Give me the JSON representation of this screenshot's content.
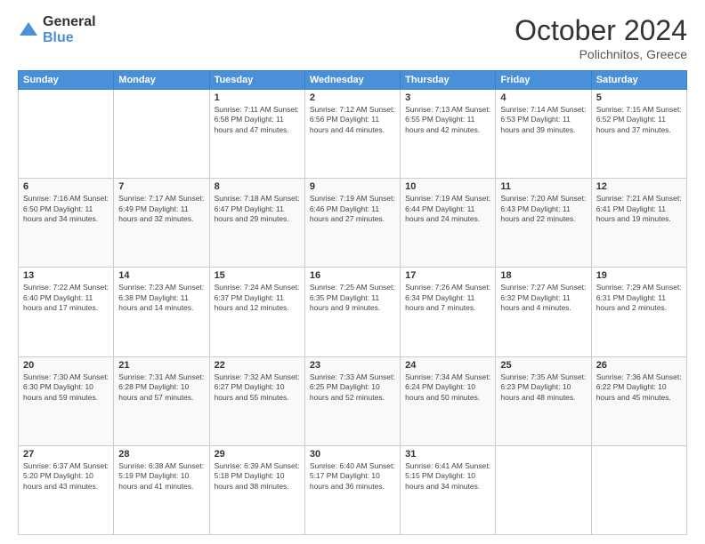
{
  "logo": {
    "general": "General",
    "blue": "Blue"
  },
  "header": {
    "month": "October 2024",
    "location": "Polichnitos, Greece"
  },
  "weekdays": [
    "Sunday",
    "Monday",
    "Tuesday",
    "Wednesday",
    "Thursday",
    "Friday",
    "Saturday"
  ],
  "weeks": [
    [
      {
        "day": "",
        "info": ""
      },
      {
        "day": "",
        "info": ""
      },
      {
        "day": "1",
        "info": "Sunrise: 7:11 AM\nSunset: 6:58 PM\nDaylight: 11 hours and 47 minutes."
      },
      {
        "day": "2",
        "info": "Sunrise: 7:12 AM\nSunset: 6:56 PM\nDaylight: 11 hours and 44 minutes."
      },
      {
        "day": "3",
        "info": "Sunrise: 7:13 AM\nSunset: 6:55 PM\nDaylight: 11 hours and 42 minutes."
      },
      {
        "day": "4",
        "info": "Sunrise: 7:14 AM\nSunset: 6:53 PM\nDaylight: 11 hours and 39 minutes."
      },
      {
        "day": "5",
        "info": "Sunrise: 7:15 AM\nSunset: 6:52 PM\nDaylight: 11 hours and 37 minutes."
      }
    ],
    [
      {
        "day": "6",
        "info": "Sunrise: 7:16 AM\nSunset: 6:50 PM\nDaylight: 11 hours and 34 minutes."
      },
      {
        "day": "7",
        "info": "Sunrise: 7:17 AM\nSunset: 6:49 PM\nDaylight: 11 hours and 32 minutes."
      },
      {
        "day": "8",
        "info": "Sunrise: 7:18 AM\nSunset: 6:47 PM\nDaylight: 11 hours and 29 minutes."
      },
      {
        "day": "9",
        "info": "Sunrise: 7:19 AM\nSunset: 6:46 PM\nDaylight: 11 hours and 27 minutes."
      },
      {
        "day": "10",
        "info": "Sunrise: 7:19 AM\nSunset: 6:44 PM\nDaylight: 11 hours and 24 minutes."
      },
      {
        "day": "11",
        "info": "Sunrise: 7:20 AM\nSunset: 6:43 PM\nDaylight: 11 hours and 22 minutes."
      },
      {
        "day": "12",
        "info": "Sunrise: 7:21 AM\nSunset: 6:41 PM\nDaylight: 11 hours and 19 minutes."
      }
    ],
    [
      {
        "day": "13",
        "info": "Sunrise: 7:22 AM\nSunset: 6:40 PM\nDaylight: 11 hours and 17 minutes."
      },
      {
        "day": "14",
        "info": "Sunrise: 7:23 AM\nSunset: 6:38 PM\nDaylight: 11 hours and 14 minutes."
      },
      {
        "day": "15",
        "info": "Sunrise: 7:24 AM\nSunset: 6:37 PM\nDaylight: 11 hours and 12 minutes."
      },
      {
        "day": "16",
        "info": "Sunrise: 7:25 AM\nSunset: 6:35 PM\nDaylight: 11 hours and 9 minutes."
      },
      {
        "day": "17",
        "info": "Sunrise: 7:26 AM\nSunset: 6:34 PM\nDaylight: 11 hours and 7 minutes."
      },
      {
        "day": "18",
        "info": "Sunrise: 7:27 AM\nSunset: 6:32 PM\nDaylight: 11 hours and 4 minutes."
      },
      {
        "day": "19",
        "info": "Sunrise: 7:29 AM\nSunset: 6:31 PM\nDaylight: 11 hours and 2 minutes."
      }
    ],
    [
      {
        "day": "20",
        "info": "Sunrise: 7:30 AM\nSunset: 6:30 PM\nDaylight: 10 hours and 59 minutes."
      },
      {
        "day": "21",
        "info": "Sunrise: 7:31 AM\nSunset: 6:28 PM\nDaylight: 10 hours and 57 minutes."
      },
      {
        "day": "22",
        "info": "Sunrise: 7:32 AM\nSunset: 6:27 PM\nDaylight: 10 hours and 55 minutes."
      },
      {
        "day": "23",
        "info": "Sunrise: 7:33 AM\nSunset: 6:25 PM\nDaylight: 10 hours and 52 minutes."
      },
      {
        "day": "24",
        "info": "Sunrise: 7:34 AM\nSunset: 6:24 PM\nDaylight: 10 hours and 50 minutes."
      },
      {
        "day": "25",
        "info": "Sunrise: 7:35 AM\nSunset: 6:23 PM\nDaylight: 10 hours and 48 minutes."
      },
      {
        "day": "26",
        "info": "Sunrise: 7:36 AM\nSunset: 6:22 PM\nDaylight: 10 hours and 45 minutes."
      }
    ],
    [
      {
        "day": "27",
        "info": "Sunrise: 6:37 AM\nSunset: 5:20 PM\nDaylight: 10 hours and 43 minutes."
      },
      {
        "day": "28",
        "info": "Sunrise: 6:38 AM\nSunset: 5:19 PM\nDaylight: 10 hours and 41 minutes."
      },
      {
        "day": "29",
        "info": "Sunrise: 6:39 AM\nSunset: 5:18 PM\nDaylight: 10 hours and 38 minutes."
      },
      {
        "day": "30",
        "info": "Sunrise: 6:40 AM\nSunset: 5:17 PM\nDaylight: 10 hours and 36 minutes."
      },
      {
        "day": "31",
        "info": "Sunrise: 6:41 AM\nSunset: 5:15 PM\nDaylight: 10 hours and 34 minutes."
      },
      {
        "day": "",
        "info": ""
      },
      {
        "day": "",
        "info": ""
      }
    ]
  ]
}
